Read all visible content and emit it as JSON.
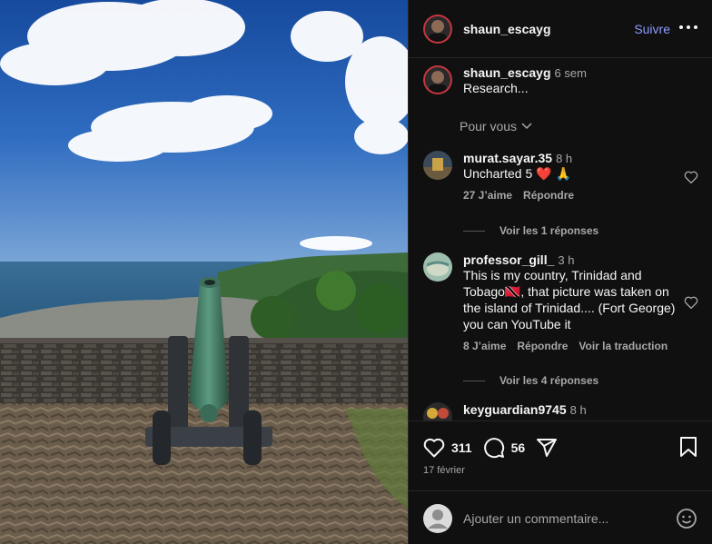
{
  "post": {
    "author": "shaun_escayg",
    "follow_label": "Suivre",
    "caption_age": "6 sem",
    "caption_text": "Research..."
  },
  "filter": {
    "label": "Pour vous"
  },
  "comments": [
    {
      "user": "murat.sayar.35",
      "age": "8 h",
      "text": "Uncharted 5 ❤️ 🙏",
      "like_count": "27 J’aime",
      "reply": "Répondre",
      "view_replies": "Voir les 1 réponses"
    },
    {
      "user": "professor_gill_",
      "age": "3 h",
      "text": "This is my country, Trinidad and Tobago🇹🇹, that picture was taken on the island of Trinidad.... (Fort George) you can YouTube it",
      "like_count": "8 J’aime",
      "reply": "Répondre",
      "translate": "Voir la traduction",
      "view_replies": "Voir les 4 réponses"
    },
    {
      "user": "keyguardian9745",
      "age": "8 h"
    }
  ],
  "footer": {
    "likes": "311",
    "comments": "56",
    "date": "17 février",
    "add_comment_placeholder": "Ajouter un commentaire..."
  },
  "colors": {
    "accent": "#8c9bff",
    "panel_bg": "#101010",
    "muted": "#a8a8a8"
  },
  "icons": [
    "more-icon",
    "chevron-down-icon",
    "heart-icon",
    "comment-icon",
    "share-icon",
    "bookmark-icon",
    "emoji-icon"
  ]
}
